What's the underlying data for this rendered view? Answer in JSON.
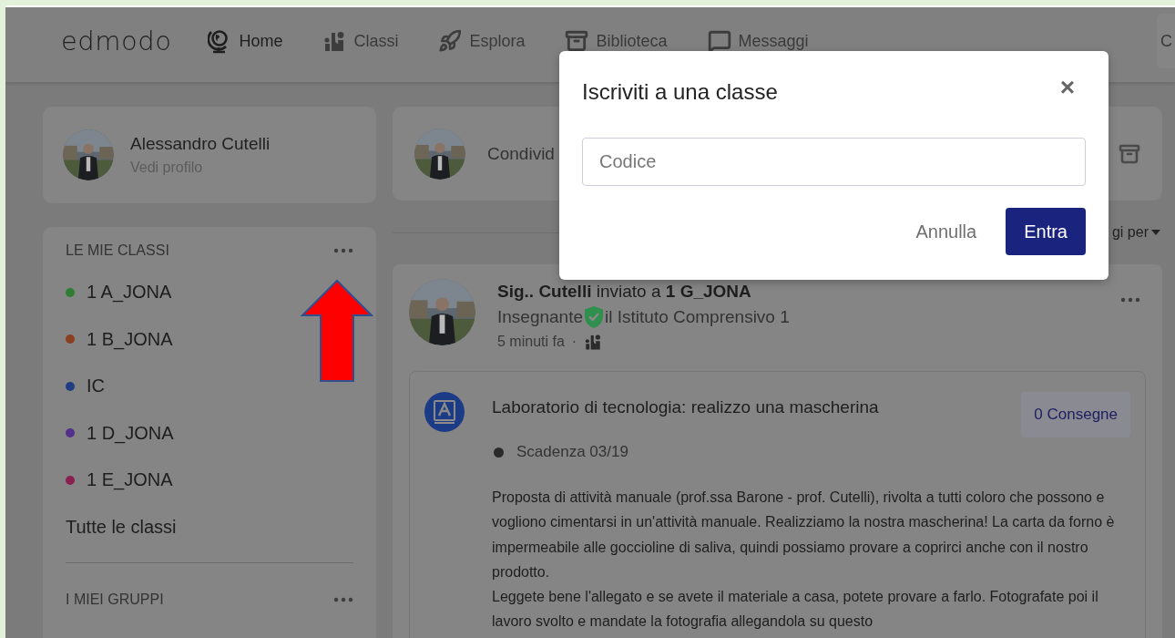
{
  "nav": {
    "logo": "edmodo",
    "items": [
      {
        "label": "Home",
        "kind": "globe",
        "selected": true
      },
      {
        "label": "Classi",
        "kind": "people",
        "selected": false
      },
      {
        "label": "Esplora",
        "kind": "rocket",
        "selected": false
      },
      {
        "label": "Biblioteca",
        "kind": "library",
        "selected": false
      },
      {
        "label": "Messaggi",
        "kind": "message",
        "selected": false
      }
    ],
    "search": {
      "placeholder": "C"
    }
  },
  "profile": {
    "name": "Alessandro Cutelli",
    "link": "Vedi profilo"
  },
  "classes": {
    "title": "LE MIE CLASSI",
    "items": [
      {
        "name": "1 A_JONA",
        "color": "#2e7d32"
      },
      {
        "name": "1 B_JONA",
        "color": "#8a3f1e"
      },
      {
        "name": "IC",
        "color": "#1f3f82"
      },
      {
        "name": "1 D_JONA",
        "color": "#55308a"
      },
      {
        "name": "1 E_JONA",
        "color": "#8a1f52"
      }
    ],
    "all_link": "Tutte le classi"
  },
  "groups": {
    "title": "I MIEI GRUPPI"
  },
  "share": {
    "placeholder": "Condivid"
  },
  "sort": {
    "label": "gi per"
  },
  "post": {
    "author": "Sig.. Cutelli",
    "verb": "inviato a",
    "target": "1 G_JONA",
    "role": "Insegnante",
    "school": "il Istituto Comprensivo 1",
    "time": "5 minuti fa",
    "separator": "·",
    "assignment": {
      "title": "Laboratorio di tecnologia: realizzo una mascherina",
      "submissions": "0 Consegne",
      "due": "Scadenza 03/19",
      "paragraphs": [
        "Proposta di attività manuale (prof.ssa Barone - prof. Cutelli), rivolta a tutti coloro che possono e vogliono cimentarsi in un'attività manuale. Realizziamo la nostra mascherina! La carta da forno è impermeabile alle goccioline di saliva, quindi possiamo provare a coprirci anche con il nostro prodotto.",
        "Leggete bene l'allegato e se avete il materiale a casa, potete provare a farlo. Fotografate poi il lavoro svolto e mandate la fotografia allegandola su questo"
      ]
    }
  },
  "modal": {
    "title": "Iscriviti a una classe",
    "close": "×",
    "field": {
      "placeholder": "Codice"
    },
    "cancel": "Annulla",
    "confirm": "Entra"
  }
}
